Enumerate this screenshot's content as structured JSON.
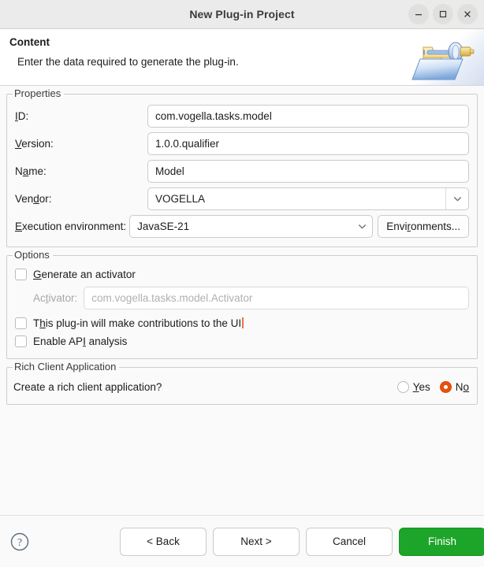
{
  "window": {
    "title": "New Plug-in Project",
    "controls": {
      "minimize": "minimize-icon",
      "maximize": "maximize-icon",
      "close": "close-icon"
    }
  },
  "header": {
    "title": "Content",
    "subtitle": "Enter the data required to generate the plug-in.",
    "icon": "plugin-folder-icon"
  },
  "properties": {
    "group_label": "Properties",
    "fields": [
      {
        "label_pre": "",
        "label_mn": "I",
        "label_post": "D:",
        "value": "com.vogella.tasks.model",
        "kind": "text"
      },
      {
        "label_pre": "",
        "label_mn": "V",
        "label_post": "ersion:",
        "value": "1.0.0.qualifier",
        "kind": "text"
      },
      {
        "label_pre": "N",
        "label_mn": "a",
        "label_post": "me:",
        "value": "Model",
        "kind": "text"
      },
      {
        "label_pre": "Ven",
        "label_mn": "d",
        "label_post": "or:",
        "value": "VOGELLA",
        "kind": "combo-split"
      }
    ],
    "execution": {
      "label_pre": "",
      "label_mn": "E",
      "label_post": "xecution environment:",
      "value": "JavaSE-21",
      "button_pre": "Envi",
      "button_mn": "r",
      "button_post": "onments..."
    }
  },
  "options": {
    "group_label": "Options",
    "generate_activator": {
      "pre": "",
      "mn": "G",
      "post": "enerate an activator",
      "checked": false
    },
    "activator_field": {
      "label_pre": "Ac",
      "label_mn": "t",
      "label_post": "ivator:",
      "value": "com.vogella.tasks.model.Activator",
      "disabled": true
    },
    "ui_contributions": {
      "pre": "T",
      "mn": "h",
      "post": "is plug-in will make contributions to the UI",
      "checked": false,
      "has_caret": true
    },
    "api_analysis": {
      "pre": "Enable AP",
      "mn": "I",
      "post": " analysis",
      "checked": false
    }
  },
  "rich_client": {
    "group_label": "Rich Client Application",
    "question": "Create a rich client application?",
    "yes": {
      "pre": "",
      "mn": "Y",
      "post": "es",
      "selected": false
    },
    "no": {
      "pre": "N",
      "mn": "o",
      "post": "",
      "selected": true
    }
  },
  "footer": {
    "help": "help-icon",
    "back": "< Back",
    "next": "Next >",
    "cancel": "Cancel",
    "finish": "Finish"
  },
  "colors": {
    "accent_orange": "#e8510c",
    "finish_green": "#1da52a",
    "window_bg": "#fafafa",
    "titlebar_bg": "#ebebeb"
  }
}
